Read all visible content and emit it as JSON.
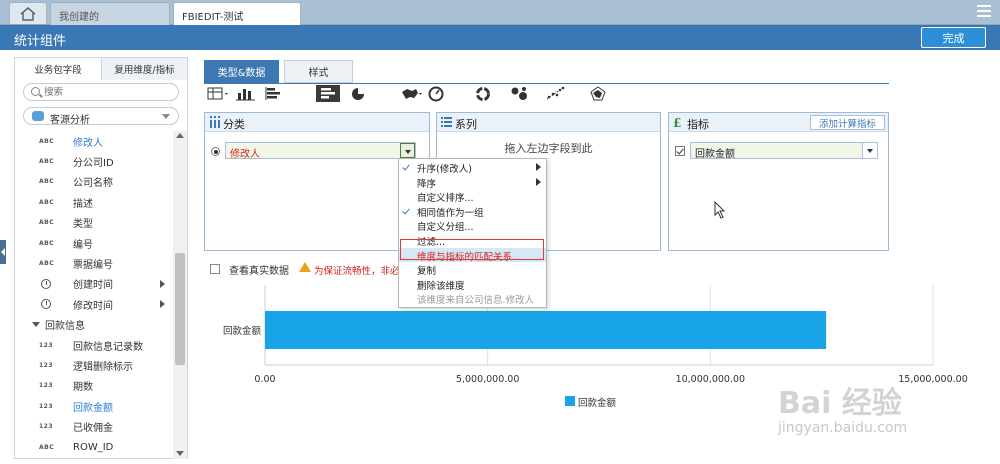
{
  "topbar": {
    "tabs": [
      {
        "label": "我创建的"
      },
      {
        "label": "FBIEDIT-测试"
      }
    ]
  },
  "header": {
    "title": "统计组件",
    "done_label": "完成"
  },
  "left_panel": {
    "tabs": [
      "业务包字段",
      "复用维度/指标"
    ],
    "search_placeholder": "搜索",
    "source": "客源分析",
    "fields": [
      {
        "type": "ABC",
        "name": "修改人",
        "highlight": true
      },
      {
        "type": "ABC",
        "name": "分公司ID"
      },
      {
        "type": "ABC",
        "name": "公司名称"
      },
      {
        "type": "ABC",
        "name": "描述"
      },
      {
        "type": "ABC",
        "name": "类型"
      },
      {
        "type": "ABC",
        "name": "编号"
      },
      {
        "type": "ABC",
        "name": "票据编号"
      },
      {
        "type": "time",
        "name": "创建时间",
        "submenu": true
      },
      {
        "type": "time",
        "name": "修改时间",
        "submenu": true
      },
      {
        "type": "group",
        "name": "回款信息"
      },
      {
        "type": "123",
        "name": "回款信息记录数"
      },
      {
        "type": "123",
        "name": "逻辑删除标示"
      },
      {
        "type": "123",
        "name": "期数"
      },
      {
        "type": "123",
        "name": "回款金额",
        "highlight": true
      },
      {
        "type": "123",
        "name": "已收佣金"
      },
      {
        "type": "ABC",
        "name": "ROW_ID"
      }
    ]
  },
  "main_tabs": [
    "类型&数据",
    "样式"
  ],
  "panels": {
    "classification": {
      "title": "分类",
      "dimension": "修改人"
    },
    "series": {
      "title": "系列",
      "placeholder": "拖入左边字段到此"
    },
    "indicator": {
      "title": "指标",
      "add_label": "添加计算指标",
      "value": "回款金额"
    }
  },
  "real_data": {
    "label": "查看真实数据",
    "warning": "为保证流畅性，非必要"
  },
  "context_menu": {
    "items": [
      {
        "label": "升序(修改人)",
        "checked": true,
        "submenu": true
      },
      {
        "label": "降序",
        "submenu": true
      },
      {
        "label": "自定义排序..."
      },
      {
        "label": "相同值作为一组",
        "checked": true
      },
      {
        "label": "自定义分组..."
      },
      {
        "label": "过滤..."
      },
      {
        "label": "维度与指标的匹配关系...",
        "highlight": true
      },
      {
        "label": "复制"
      },
      {
        "label": "删除该维度"
      },
      {
        "label": "该维度来自公司信息.修改人",
        "disabled": true
      }
    ]
  },
  "chart_data": {
    "type": "bar",
    "orientation": "horizontal",
    "categories": [
      "回款金额"
    ],
    "series": [
      {
        "name": "回款金额",
        "values": [
          12600000
        ]
      }
    ],
    "xlim": [
      0,
      15000000
    ],
    "x_ticks": [
      "0.00",
      "5,000,000.00",
      "10,000,000.00",
      "15,000,000.00"
    ],
    "color": "#1aa4e8",
    "legend": "bottom"
  },
  "watermark": {
    "line1": "Bai 经验",
    "line2": "jingyan.baidu.com"
  }
}
